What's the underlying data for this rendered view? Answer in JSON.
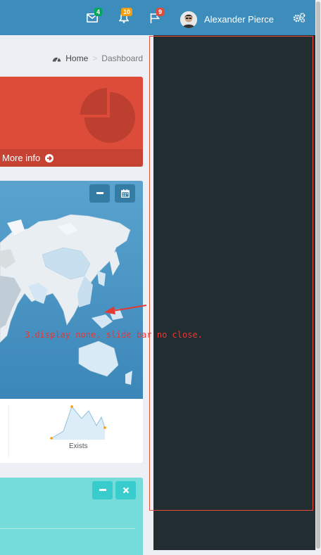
{
  "header": {
    "user_name": "Alexander Pierce",
    "messages_count": "4",
    "notifications_count": "10",
    "tasks_count": "9",
    "colors": {
      "bar": "#3c8dbc",
      "messages_badge": "#00a65a",
      "notifications_badge": "#f39c12",
      "tasks_badge": "#dd4b39"
    }
  },
  "breadcrumb": {
    "home": "Home",
    "separator": ">",
    "current": "Dashboard"
  },
  "small_box": {
    "footer_label": "More info",
    "color": "#dd4b39"
  },
  "map_box": {
    "color": "#3c8dbc",
    "tools": [
      "minus-icon",
      "calendar-icon"
    ]
  },
  "map_footer": {
    "sparkline_label": "Exists"
  },
  "teal_box": {
    "color": "#76dcd9",
    "tools": [
      "minus-icon",
      "times-icon"
    ]
  },
  "sidebar": {
    "color": "#222d32"
  },
  "annotation": {
    "text": "3.display none, slide bar no close."
  }
}
